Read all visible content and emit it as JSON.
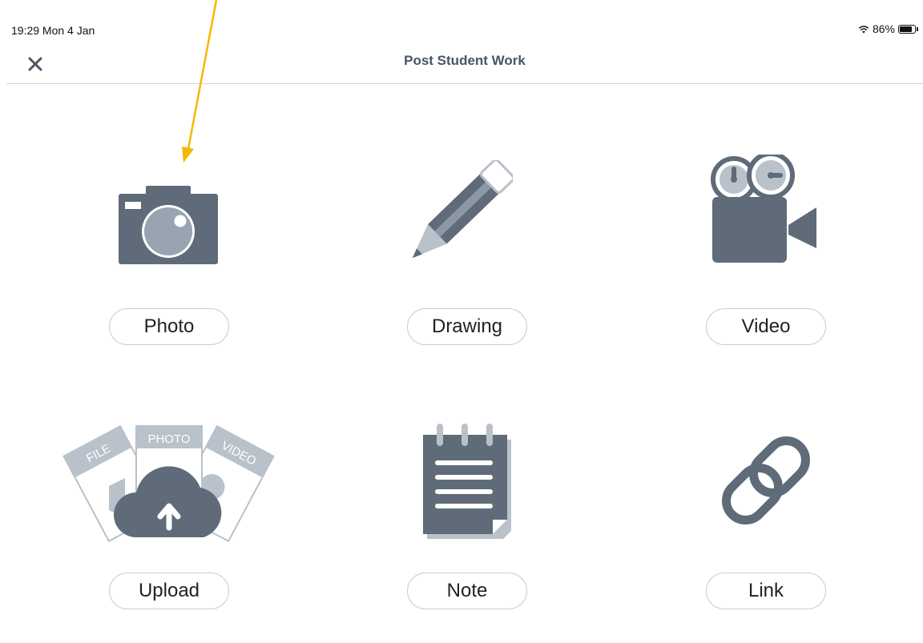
{
  "status_bar": {
    "time": "19:29  Mon 4 Jan",
    "battery_text": "86%",
    "battery_level": 0.86
  },
  "nav": {
    "title": "Post Student Work",
    "close_icon": "close-icon"
  },
  "options": [
    {
      "label": "Photo",
      "icon": "camera-icon"
    },
    {
      "label": "Drawing",
      "icon": "pencil-icon"
    },
    {
      "label": "Video",
      "icon": "video-camera-icon"
    },
    {
      "label": "Upload",
      "icon": "cloud-upload-icon",
      "icon_texts": {
        "file": "FILE",
        "photo": "PHOTO",
        "video": "VIDEO"
      }
    },
    {
      "label": "Note",
      "icon": "notepad-icon"
    },
    {
      "label": "Link",
      "icon": "link-icon"
    }
  ],
  "colors": {
    "icon_dark": "#5f6b78",
    "icon_light": "#b9c1ca",
    "title": "#4a5563",
    "divider": "#cfd3d8",
    "annotation_arrow": "#f5b800"
  }
}
